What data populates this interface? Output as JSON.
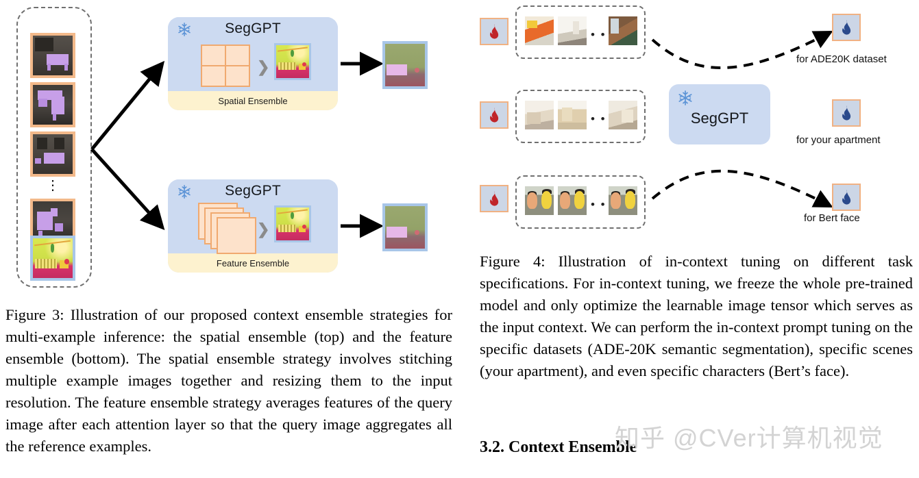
{
  "figure3": {
    "module_top": {
      "title": "SegGPT",
      "footer_label": "Spatial  Ensemble",
      "freeze_icon": "snowflake-icon",
      "arrow_glyph": "❯"
    },
    "module_bottom": {
      "title": "SegGPT",
      "footer_label": "Feature Ensemble",
      "freeze_icon": "snowflake-icon",
      "arrow_glyph": "❯"
    },
    "example_stack": {
      "vertical_ellipsis": "⋮",
      "reference_count_shown": 4,
      "query_label": "query-image"
    },
    "caption": "Figure 3:  Illustration of our proposed context ensemble strategies for multi-example inference: the spatial ensemble (top) and the feature ensemble (bottom).  The spatial ensemble strategy involves stitching multiple example images together and resizing them to the input resolution. The feature ensemble strategy averages features of the query image after each attention layer so that the query image aggregates all the reference examples."
  },
  "figure4": {
    "model_box": {
      "title": "SegGPT",
      "freeze_icon": "snowflake-icon"
    },
    "rows": [
      {
        "tunable_icon": "red-flame-icon",
        "dots": "• • •",
        "output_icon": "blue-flame-icon",
        "label": "for ADE20K dataset"
      },
      {
        "tunable_icon": "red-flame-icon",
        "dots": "• • •",
        "output_icon": "blue-flame-icon",
        "label": "for your apartment"
      },
      {
        "tunable_icon": "red-flame-icon",
        "dots": "• • •",
        "output_icon": "blue-flame-icon",
        "label": "for Bert face"
      }
    ],
    "caption": "Figure 4: Illustration of in-context tuning on different task specifications.  For in-context tuning, we freeze the whole pre-trained model and only optimize the learnable image tensor which serves as the input context. We can perform the in-context prompt tuning on the specific datasets (ADE-20K semantic segmentation), specific scenes (your apartment), and even specific characters (Bert’s face)."
  },
  "section": {
    "heading": "3.2. Context Ensemble"
  },
  "watermark": {
    "text": "知乎 @CVer计算机视觉"
  },
  "colors": {
    "module_blue": "#ccdaf1",
    "module_footer_cream": "#fdf2cf",
    "ref_border_orange": "#f3b98a",
    "query_border_blue": "#a8c6e8",
    "grid_orange": "#f0a96f",
    "grid_fill": "#fde2cb",
    "dashed_gray": "#6f6f6f",
    "flame_red": "#c0252a",
    "flame_blue": "#2b4a8c",
    "watermark_gray": "#d3d3d3"
  }
}
